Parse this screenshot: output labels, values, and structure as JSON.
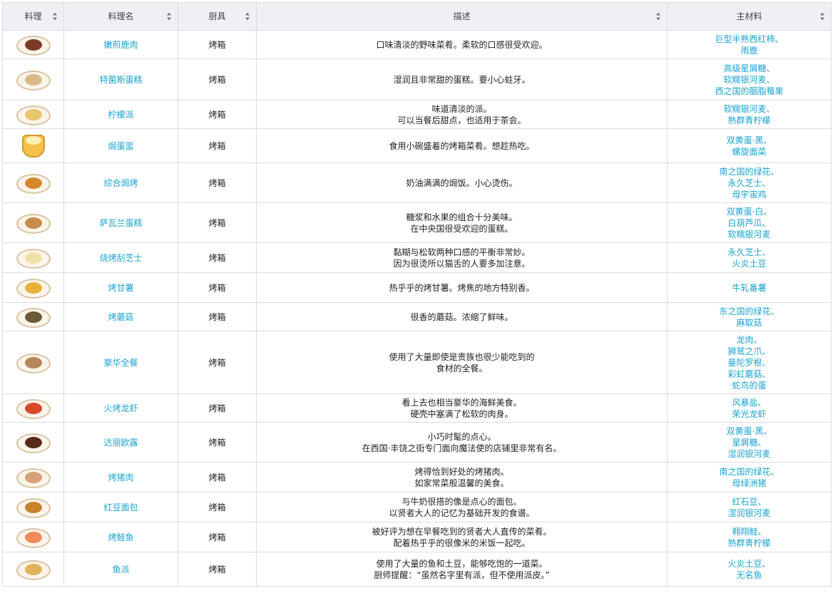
{
  "table": {
    "headers": [
      "料理",
      "料理名",
      "厨具",
      "描述",
      "主材料"
    ],
    "rows": [
      {
        "icon": "grilled-meat-dish-icon",
        "food_color": "#7a3a28",
        "name": "嫩煎鹿肉",
        "tool": "烤箱",
        "desc": [
          "口味清淡的野味菜肴。柔软的口感很受欢迎。"
        ],
        "ingredients": [
          "巨型半熟西红柿、",
          "雨鹿"
        ]
      },
      {
        "icon": "cake-dish-icon",
        "food_color": "#d9b98a",
        "name": "特菌斯蛋糕",
        "tool": "烤箱",
        "desc": [
          "湿润且非常甜的蛋糕。要小心蛀牙。"
        ],
        "ingredients": [
          "高级星屑糖、",
          "软糯银河麦、",
          "西之国的胭脂莓果"
        ]
      },
      {
        "icon": "pie-dish-icon",
        "food_color": "#e8c66a",
        "name": "柠檬派",
        "tool": "烤箱",
        "desc": [
          "味道清淡的派。",
          "可以当餐后甜点，也适用于茶会。"
        ],
        "ingredients": [
          "软糯银河麦、",
          "熟群青柠檬"
        ]
      },
      {
        "icon": "egg-bowl-icon",
        "food_color": "#fff2b0",
        "name": "焗蛋盅",
        "tool": "烤箱",
        "desc": [
          "食用小碗盛着的烤箱菜肴。想趁热吃。"
        ],
        "ingredients": [
          "双黄蛋·黑、",
          "螺旋面菜"
        ],
        "bowl": true
      },
      {
        "icon": "casserole-dish-icon",
        "food_color": "#d6872a",
        "name": "综合焗烤",
        "tool": "烤箱",
        "desc": [
          "奶油满满的焗饭。小心烫伤。"
        ],
        "ingredients": [
          "南之国的绿花、",
          "永久芝士、",
          "母宇宙鸡"
        ]
      },
      {
        "icon": "savarin-cake-dish-icon",
        "food_color": "#c98b4a",
        "name": "萨瓦兰蛋糕",
        "tool": "烤箱",
        "desc": [
          "糖浆和水果的组合十分美味。",
          "在中央国很受欢迎的蛋糕。"
        ],
        "ingredients": [
          "双黄蛋·白、",
          "白葫芦瓜、",
          "软糯银河麦"
        ]
      },
      {
        "icon": "cheese-gratin-dish-icon",
        "food_color": "#f0e1a8",
        "name": "烧烤刮芝士",
        "tool": "烤箱",
        "desc": [
          "黏糊与松软两种口感的平衡非常妙。",
          "因为很烫所以猫舌的人要多加注意。"
        ],
        "ingredients": [
          "永久芝士、",
          "火炎土豆"
        ]
      },
      {
        "icon": "sweet-potato-dish-icon",
        "food_color": "#e7b23a",
        "name": "烤甘薯",
        "tool": "烤箱",
        "desc": [
          "热乎乎的烤甘薯。烤焦的地方特别香。"
        ],
        "ingredients": [
          "牛轧番薯"
        ]
      },
      {
        "icon": "mushroom-dish-icon",
        "food_color": "#6a5a3a",
        "name": "烤蘑菇",
        "tool": "烤箱",
        "desc": [
          "很香的蘑菇。浓缩了鲜味。"
        ],
        "ingredients": [
          "东之国的绿花、",
          "麻取菇"
        ]
      },
      {
        "icon": "full-course-dish-icon",
        "food_color": "#b8875a",
        "name": "豪华全餐",
        "tool": "烤箱",
        "desc": [
          "使用了大量即使是贵族也很少能吃到的",
          "食材的全餐。"
        ],
        "ingredients": [
          "龙肉、",
          "狮鹫之爪、",
          "曼陀罗根、",
          "彩虹蘑菇、",
          "蛇鸟的蛋"
        ]
      },
      {
        "icon": "lobster-dish-icon",
        "food_color": "#d9482a",
        "name": "火烤龙虾",
        "tool": "烤箱",
        "desc": [
          "看上去也相当豪华的海鲜美食。",
          "硬壳中塞满了松软的肉身。"
        ],
        "ingredients": [
          "风暴盐、",
          "荣光龙虾"
        ]
      },
      {
        "icon": "dariole-dish-icon",
        "food_color": "#5a2a1a",
        "name": "达丽欧露",
        "tool": "烤箱",
        "desc": [
          "小巧时髦的点心。",
          "在西国·丰饶之街专门面向魔法使的店铺里非常有名。"
        ],
        "ingredients": [
          "双黄蛋·黑、",
          "星屑糖、",
          "湿润银河麦"
        ]
      },
      {
        "icon": "roast-pork-dish-icon",
        "food_color": "#d7a07a",
        "name": "烤猪肉",
        "tool": "烤箱",
        "desc": [
          "烤得恰到好处的烤猪肉。",
          "如家常菜般温馨的美食。"
        ],
        "ingredients": [
          "南之国的绿花、",
          "母绿洲猪"
        ]
      },
      {
        "icon": "red-bean-bread-icon",
        "food_color": "#c9822e",
        "name": "红豆面包",
        "tool": "烤箱",
        "desc": [
          "与牛奶很搭的像是点心的面包。",
          "以贤者大人的记忆为基础开发的食谱。"
        ],
        "ingredients": [
          "红石豆、",
          "湿润银河麦"
        ]
      },
      {
        "icon": "salmon-dish-icon",
        "food_color": "#f08a5a",
        "name": "烤鲑鱼",
        "tool": "烤箱",
        "desc": [
          "被好评为想在早餐吃到的贤者大人直传的菜肴。",
          "配着热乎乎的很像米的米饭一起吃。"
        ],
        "ingredients": [
          "翱翔鲑、",
          "熟群青柠檬"
        ]
      },
      {
        "icon": "fish-pie-dish-icon",
        "food_color": "#e0b45a",
        "name": "鱼派",
        "tool": "烤箱",
        "desc": [
          "使用了大量的鱼和土豆，能够吃饱的一道菜。",
          "厨师提醒：“虽然名字里有派，但不使用派皮。”"
        ],
        "ingredients": [
          "火炎土豆、",
          "无名鱼"
        ]
      }
    ]
  }
}
